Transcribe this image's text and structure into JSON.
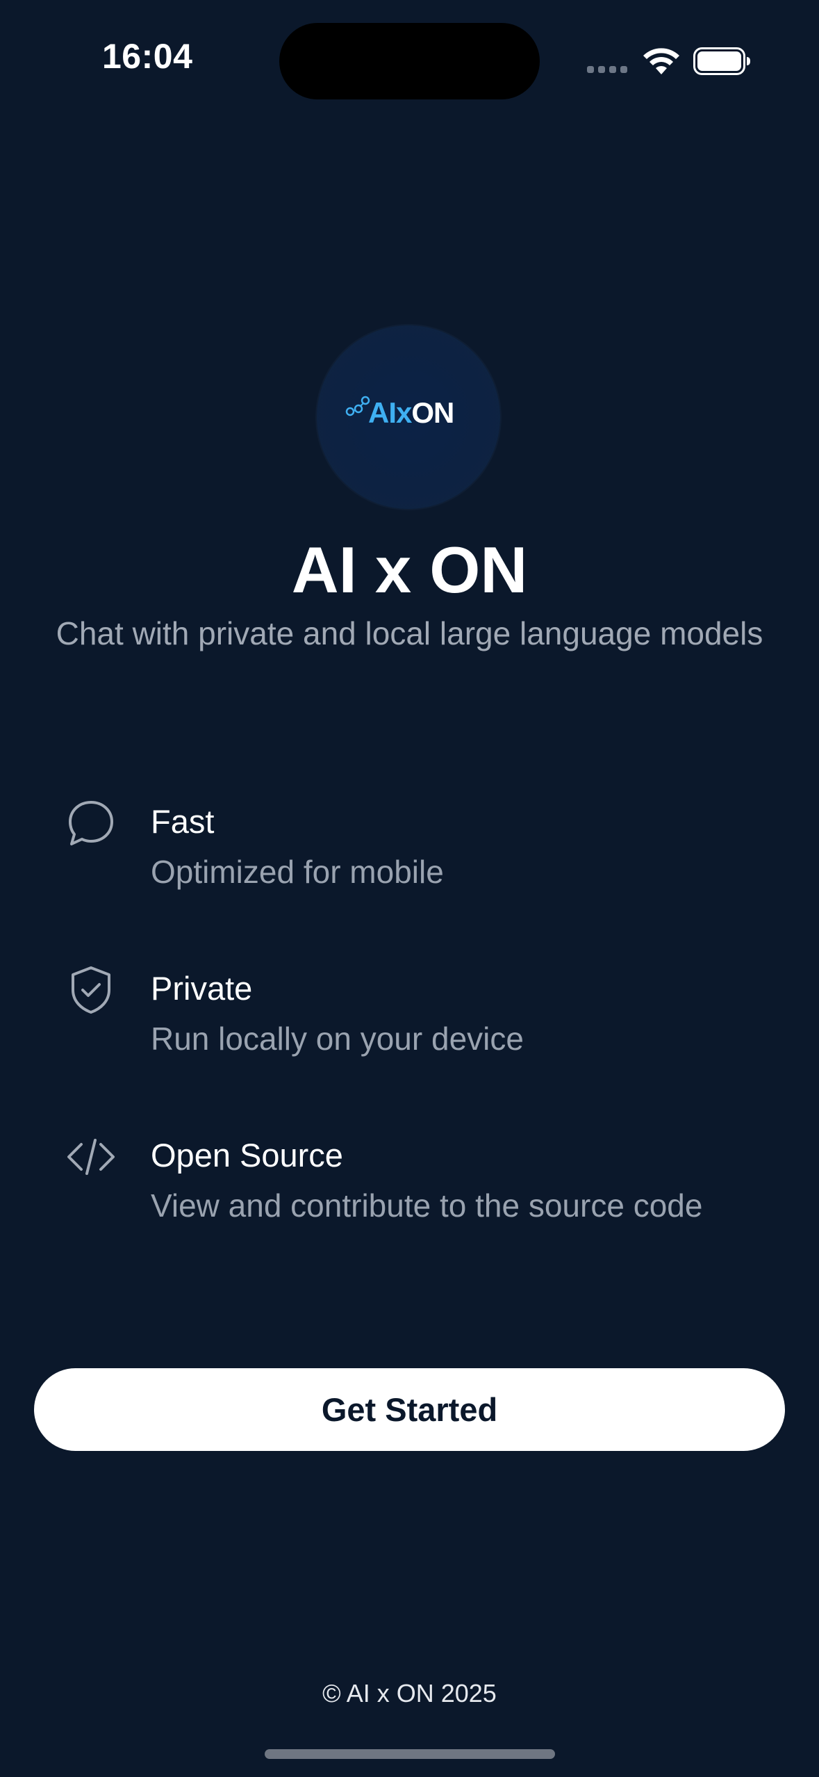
{
  "status_bar": {
    "time": "16:04"
  },
  "logo": {
    "text_ai": "AIx",
    "text_on": "ON",
    "accent_color": "#3fb0f2"
  },
  "header": {
    "title": "AI x ON",
    "subtitle": "Chat with private and local large language models"
  },
  "features": [
    {
      "icon": "chat-bubble-icon",
      "title": "Fast",
      "description": "Optimized for mobile"
    },
    {
      "icon": "shield-check-icon",
      "title": "Private",
      "description": "Run locally on your device"
    },
    {
      "icon": "code-icon",
      "title": "Open Source",
      "description": "View and contribute to the source code"
    }
  ],
  "cta": {
    "label": "Get Started"
  },
  "footer": {
    "text": "© AI x ON 2025"
  },
  "colors": {
    "background": "#0b182b",
    "button_bg": "#ffffff",
    "button_text": "#0b182b",
    "muted_text": "#9aa3b0"
  }
}
